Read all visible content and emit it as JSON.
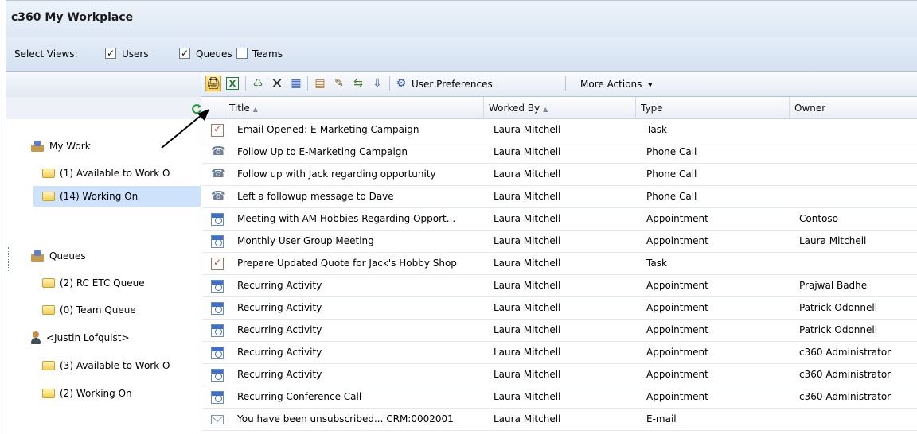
{
  "window": {
    "title": "c360 My Workplace"
  },
  "views": {
    "label": "Select Views:",
    "options": [
      {
        "label": "Users",
        "checked": true
      },
      {
        "label": "Queues",
        "checked": true
      },
      {
        "label": "Teams",
        "checked": false
      }
    ]
  },
  "toolbar": {
    "buttons": [
      {
        "icon": "print-icon",
        "glyph": "🖨"
      },
      {
        "icon": "excel-icon",
        "glyph": "X"
      },
      {
        "icon": "assign-icon",
        "glyph": "♺"
      },
      {
        "icon": "delete-icon",
        "glyph": "✕"
      },
      {
        "icon": "save-icon",
        "glyph": "▦"
      },
      {
        "icon": "properties-icon",
        "glyph": "▤"
      },
      {
        "icon": "edit-icon",
        "glyph": "✎"
      },
      {
        "icon": "queue-icon",
        "glyph": "⇆"
      },
      {
        "icon": "release-icon",
        "glyph": "⇩"
      }
    ],
    "user_preferences": "User Preferences",
    "more_actions": "More Actions",
    "more_actions_glyph": "▾"
  },
  "columns": [
    {
      "label": "Title",
      "sort": "▲"
    },
    {
      "label": "Worked By",
      "sort": "▲"
    },
    {
      "label": "Type",
      "sort": ""
    },
    {
      "label": "Owner",
      "sort": ""
    }
  ],
  "sidebar": {
    "items": [
      {
        "label": "My Work",
        "icon": "inbox",
        "level": 0
      },
      {
        "label": "(1) Available to Work O",
        "icon": "folder",
        "level": 1
      },
      {
        "label": "(14) Working On",
        "icon": "folder",
        "level": 1,
        "selected": true
      },
      {
        "label": "Queues",
        "icon": "inbox",
        "level": 0
      },
      {
        "label": "(2) RC ETC Queue",
        "icon": "folder",
        "level": 1
      },
      {
        "label": "(0) Team Queue",
        "icon": "folder",
        "level": 1
      },
      {
        "label": "<Justin Lofquist>",
        "icon": "person",
        "level": 0
      },
      {
        "label": "(3) Available to Work O",
        "icon": "folder",
        "level": 1
      },
      {
        "label": "(2) Working On",
        "icon": "folder",
        "level": 1
      }
    ]
  },
  "rows": [
    {
      "icon": "task",
      "title": "Email Opened: E-Marketing Campaign",
      "worked_by": "Laura Mitchell",
      "type": "Task",
      "owner": ""
    },
    {
      "icon": "phone",
      "title": "Follow Up to E-Marketing Campaign",
      "worked_by": "Laura Mitchell",
      "type": "Phone Call",
      "owner": ""
    },
    {
      "icon": "phone",
      "title": "Follow up with Jack regarding opportunity",
      "worked_by": "Laura Mitchell",
      "type": "Phone Call",
      "owner": ""
    },
    {
      "icon": "phone",
      "title": "Left a followup message to Dave",
      "worked_by": "Laura Mitchell",
      "type": "Phone Call",
      "owner": ""
    },
    {
      "icon": "appt",
      "title": "Meeting with AM Hobbies Regarding Opport...",
      "worked_by": "Laura Mitchell",
      "type": "Appointment",
      "owner": "Contoso"
    },
    {
      "icon": "appt",
      "title": "Monthly User Group Meeting",
      "worked_by": "Laura Mitchell",
      "type": "Appointment",
      "owner": "Laura Mitchell"
    },
    {
      "icon": "task",
      "title": "Prepare Updated Quote for Jack's Hobby Shop",
      "worked_by": "Laura Mitchell",
      "type": "Task",
      "owner": ""
    },
    {
      "icon": "appt",
      "title": "Recurring Activity",
      "worked_by": "Laura Mitchell",
      "type": "Appointment",
      "owner": "Prajwal Badhe"
    },
    {
      "icon": "appt",
      "title": "Recurring Activity",
      "worked_by": "Laura Mitchell",
      "type": "Appointment",
      "owner": "Patrick Odonnell"
    },
    {
      "icon": "appt",
      "title": "Recurring Activity",
      "worked_by": "Laura Mitchell",
      "type": "Appointment",
      "owner": "Patrick Odonnell"
    },
    {
      "icon": "appt",
      "title": "Recurring Activity",
      "worked_by": "Laura Mitchell",
      "type": "Appointment",
      "owner": "c360 Administrator"
    },
    {
      "icon": "appt",
      "title": "Recurring Activity",
      "worked_by": "Laura Mitchell",
      "type": "Appointment",
      "owner": "c360 Administrator"
    },
    {
      "icon": "appt",
      "title": "Recurring Conference Call",
      "worked_by": "Laura Mitchell",
      "type": "Appointment",
      "owner": "c360 Administrator"
    },
    {
      "icon": "mail",
      "title": "You have been unsubscribed... CRM:0002001",
      "worked_by": "Laura Mitchell",
      "type": "E-mail",
      "owner": ""
    }
  ]
}
